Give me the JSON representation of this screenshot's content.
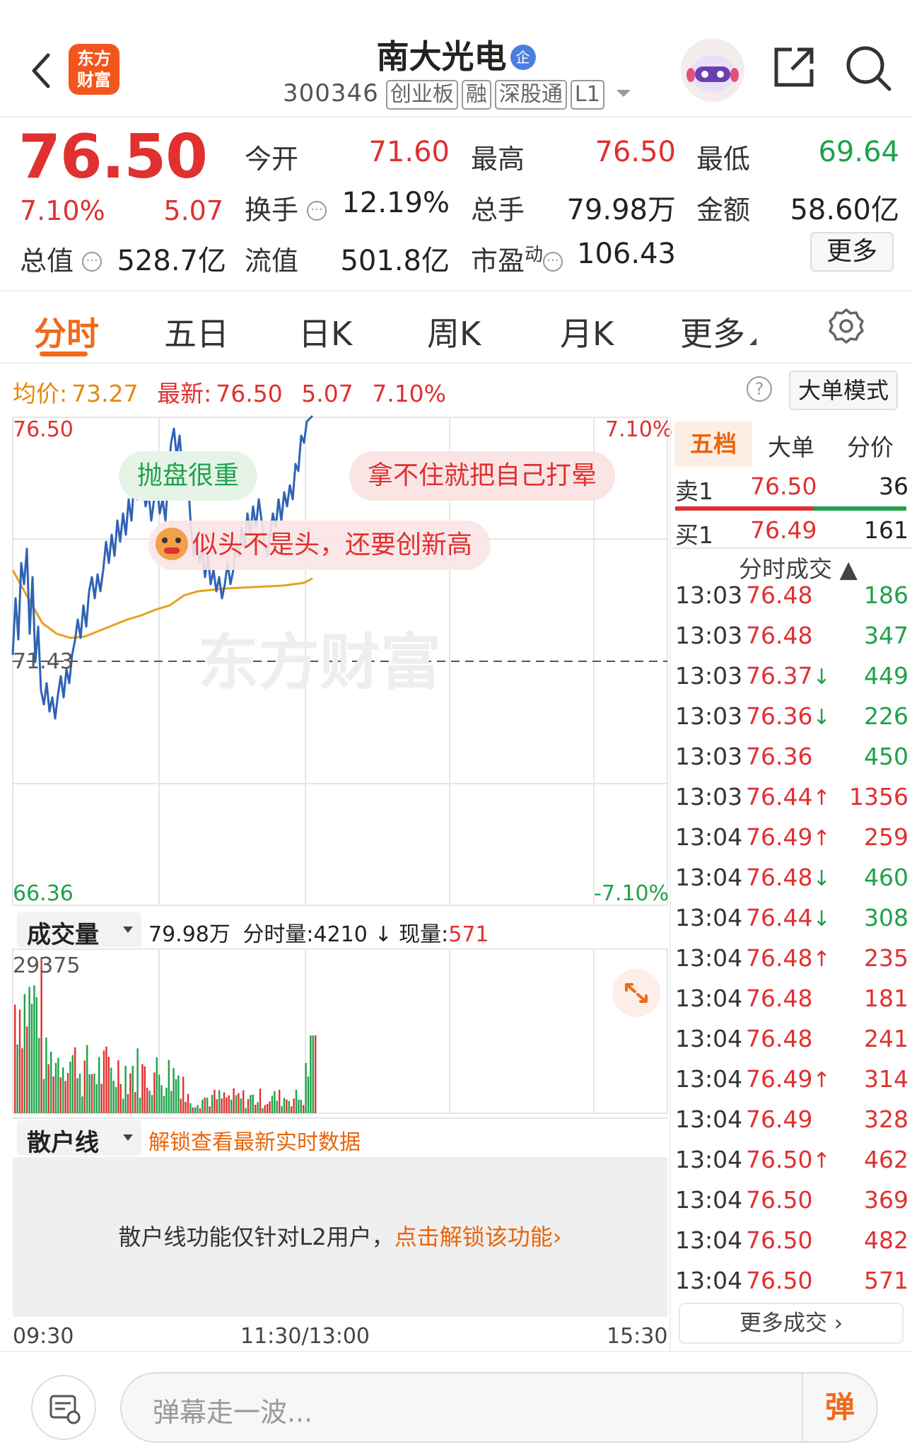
{
  "header": {
    "title": "南大光电",
    "badge": "企",
    "code": "300346",
    "tags": [
      "创业板",
      "融",
      "深股通",
      "L1"
    ],
    "logo": "东方财富"
  },
  "quote": {
    "price": "76.50",
    "change_pct": "7.10%",
    "change": "5.07",
    "open_label": "今开",
    "open": "71.60",
    "high_label": "最高",
    "high": "76.50",
    "low_label": "最低",
    "low": "69.64",
    "turnover_label": "换手",
    "turnover": "12.19%",
    "vol_label": "总手",
    "vol": "79.98万",
    "amount_label": "金额",
    "amount": "58.60亿",
    "mktcap_label": "总值",
    "mktcap": "528.7亿",
    "float_label": "流值",
    "float": "501.8亿",
    "pe_label": "市盈",
    "pe_sup": "动",
    "pe": "106.43",
    "more": "更多"
  },
  "tabs": [
    "分时",
    "五日",
    "日K",
    "周K",
    "月K",
    "更多"
  ],
  "summary": {
    "avg_label": "均价:",
    "avg": "73.27",
    "latest_label": "最新:",
    "latest": "76.50",
    "chg": "5.07",
    "pct": "7.10%",
    "mode": "大单模式"
  },
  "chart": {
    "ymax": "76.50",
    "ymin": "66.36",
    "mid": "71.43",
    "pct_top": "7.10%",
    "pct_bottom": "-7.10%",
    "watermark": "东方财富",
    "bubbles": [
      "抛盘很重",
      "拿不住就把自己打晕",
      "似头不是头，还要创新高"
    ],
    "time_start": "09:30",
    "time_mid": "11:30/13:00",
    "time_end": "15:30"
  },
  "volume": {
    "select": "成交量",
    "total": "79.98万",
    "period_label": "分时量:",
    "period": "4210",
    "now_label": "现量:",
    "now": "571",
    "ymax": "29375"
  },
  "retail": {
    "select": "散户线",
    "unlock": "解锁查看最新实时数据",
    "note": "散户线功能仅针对L2用户，",
    "link": "点击解锁该功能›"
  },
  "orderbook": {
    "tabs": [
      "五档",
      "大单",
      "分价"
    ],
    "sell_label": "卖1",
    "sell_price": "76.50",
    "sell_vol": "36",
    "buy_label": "买1",
    "buy_price": "76.49",
    "buy_vol": "161",
    "trades_title": "分时成交 ▲",
    "more": "更多成交 ›"
  },
  "trades": [
    {
      "time": "13:03",
      "price": "76.48",
      "dir": "",
      "vol": "186",
      "vc": "green"
    },
    {
      "time": "13:03",
      "price": "76.48",
      "dir": "",
      "vol": "347",
      "vc": "green"
    },
    {
      "time": "13:03",
      "price": "76.37",
      "dir": "↓",
      "vol": "449",
      "vc": "green"
    },
    {
      "time": "13:03",
      "price": "76.36",
      "dir": "↓",
      "vol": "226",
      "vc": "green"
    },
    {
      "time": "13:03",
      "price": "76.36",
      "dir": "",
      "vol": "450",
      "vc": "green"
    },
    {
      "time": "13:03",
      "price": "76.44",
      "dir": "↑",
      "vol": "1356",
      "vc": "red"
    },
    {
      "time": "13:04",
      "price": "76.49",
      "dir": "↑",
      "vol": "259",
      "vc": "red"
    },
    {
      "time": "13:04",
      "price": "76.48",
      "dir": "↓",
      "vol": "460",
      "vc": "green"
    },
    {
      "time": "13:04",
      "price": "76.44",
      "dir": "↓",
      "vol": "308",
      "vc": "green"
    },
    {
      "time": "13:04",
      "price": "76.48",
      "dir": "↑",
      "vol": "235",
      "vc": "red"
    },
    {
      "time": "13:04",
      "price": "76.48",
      "dir": "",
      "vol": "181",
      "vc": "red"
    },
    {
      "time": "13:04",
      "price": "76.48",
      "dir": "",
      "vol": "241",
      "vc": "red"
    },
    {
      "time": "13:04",
      "price": "76.49",
      "dir": "↑",
      "vol": "314",
      "vc": "red"
    },
    {
      "time": "13:04",
      "price": "76.49",
      "dir": "",
      "vol": "328",
      "vc": "red"
    },
    {
      "time": "13:04",
      "price": "76.50",
      "dir": "↑",
      "vol": "462",
      "vc": "red"
    },
    {
      "time": "13:04",
      "price": "76.50",
      "dir": "",
      "vol": "369",
      "vc": "red"
    },
    {
      "time": "13:04",
      "price": "76.50",
      "dir": "",
      "vol": "482",
      "vc": "red"
    },
    {
      "time": "13:04",
      "price": "76.50",
      "dir": "",
      "vol": "571",
      "vc": "red"
    }
  ],
  "bottom": {
    "placeholder": "弹幕走一波...",
    "danmu": "弹"
  },
  "colors": {
    "up": "#e03030",
    "down": "#1ea24a",
    "price_line": "#2f63b5",
    "avg_line": "#e8a020",
    "accent": "#f06a1a"
  }
}
